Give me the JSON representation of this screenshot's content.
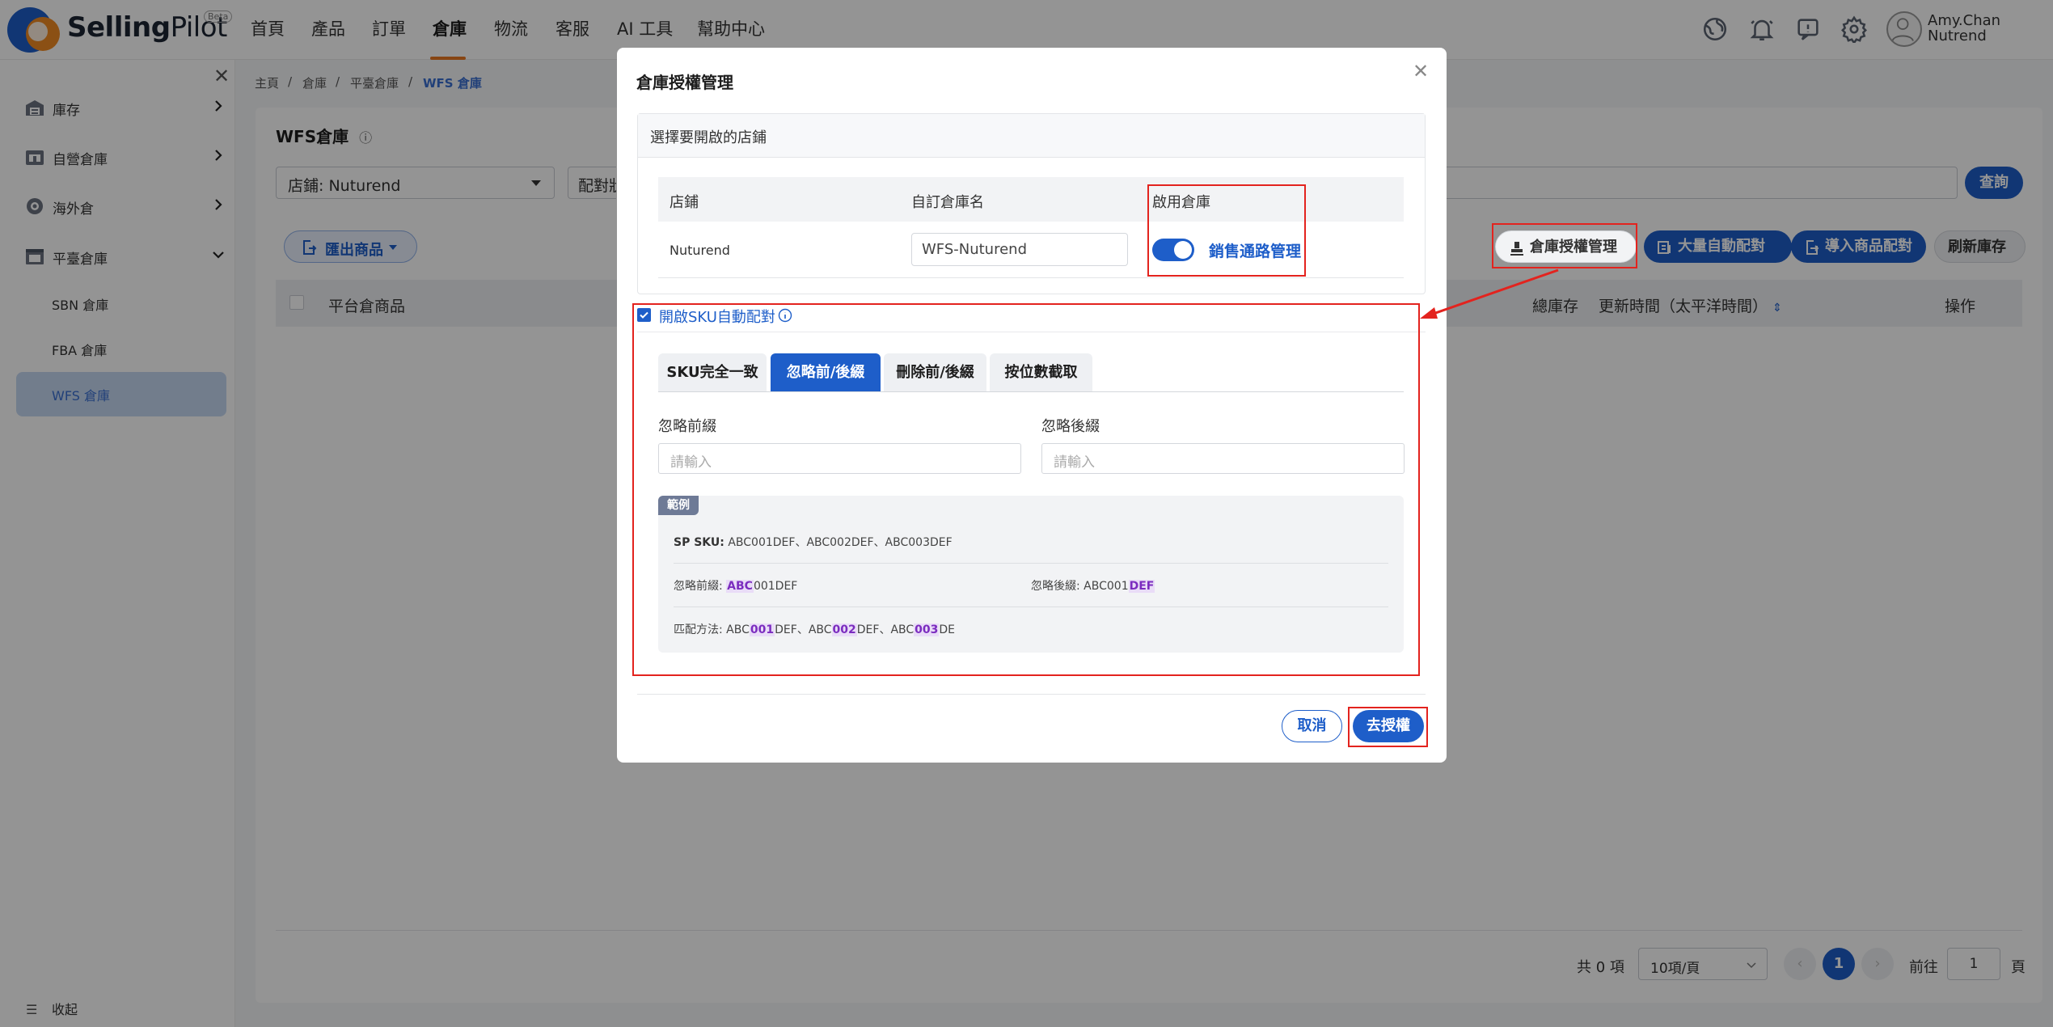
{
  "app": {
    "logo_bold": "Selling",
    "logo_light": "Pilot",
    "beta": "Beta"
  },
  "nav": [
    "首頁",
    "產品",
    "訂單",
    "倉庫",
    "物流",
    "客服",
    "AI 工具",
    "幫助中心"
  ],
  "nav_active_index": 3,
  "user": {
    "name": "Amy.Chan",
    "org": "Nutrend"
  },
  "top_icons": [
    "globe-icon",
    "bell-icon",
    "message-icon",
    "gear-icon"
  ],
  "sidebar": {
    "items": [
      {
        "label": "庫存",
        "icon": "warehouse-icon"
      },
      {
        "label": "自營倉庫",
        "icon": "store-icon"
      },
      {
        "label": "海外倉",
        "icon": "globe-warehouse-icon"
      },
      {
        "label": "平臺倉庫",
        "icon": "platform-warehouse-icon"
      }
    ],
    "sub_items": [
      "SBN 倉庫",
      "FBA 倉庫",
      "WFS 倉庫"
    ],
    "active_sub": "WFS 倉庫",
    "collapse_label": "收起"
  },
  "breadcrumb": [
    "主頁",
    "倉庫",
    "平臺倉庫",
    "WFS 倉庫"
  ],
  "page": {
    "title": "WFS倉庫",
    "store_select": "店鋪: Nuturend",
    "match_select": "配對狀",
    "query_button": "查詢",
    "export_button": "匯出商品",
    "toolbar": [
      "倉庫授權管理",
      "大量自動配對",
      "導入商品配對",
      "刷新庫存"
    ],
    "table_headers": {
      "product": "平台倉商品",
      "stock": "總庫存",
      "updated": "更新時間（太平洋時間）",
      "action": "操作"
    },
    "pagination": {
      "total": "共 0 項",
      "page_size": "10項/頁",
      "current": "1",
      "goto": "前往",
      "goto_value": "1",
      "page_unit": "頁"
    }
  },
  "modal": {
    "title": "倉庫授權管理",
    "section_title": "選擇要開啟的店鋪",
    "table_headers": {
      "store": "店鋪",
      "custom_name": "自訂倉庫名",
      "enable": "啟用倉庫"
    },
    "row": {
      "store": "Nuturend",
      "custom_name": "WFS-Nuturend",
      "enabled": true,
      "link": "銷售通路管理"
    },
    "auto_match": {
      "checked": true,
      "label": "開啟SKU自動配對"
    },
    "tabs": [
      "SKU完全一致",
      "忽略前/後綴",
      "刪除前/後綴",
      "按位數截取"
    ],
    "active_tab": 1,
    "prefix_label": "忽略前綴",
    "suffix_label": "忽略後綴",
    "prefix_placeholder": "請輸入",
    "suffix_placeholder": "請輸入",
    "example": {
      "tag": "範例",
      "sp_sku_label": "SP SKU:",
      "sp_sku_value": "ABC001DEF、ABC002DEF、ABC003DEF",
      "prefix_label": "忽略前綴:",
      "prefix_hl": "ABC",
      "prefix_rest": "001DEF",
      "suffix_label": "忽略後綴:",
      "suffix_pre": "ABC001",
      "suffix_hl": "DEF",
      "match_label": "匹配方法:",
      "match": [
        {
          "a": "ABC",
          "b": "001",
          "c": "DEF"
        },
        {
          "a": "ABC",
          "b": "002",
          "c": "DEF"
        },
        {
          "a": "ABC",
          "b": "003",
          "c": "DE"
        }
      ]
    },
    "cancel_button": "取消",
    "authorize_button": "去授權"
  },
  "colors": {
    "primary": "#1e5ec9",
    "accent_orange": "#e87722",
    "annotation_red": "#e3231e",
    "highlight_purple": "#7b2cbf"
  }
}
